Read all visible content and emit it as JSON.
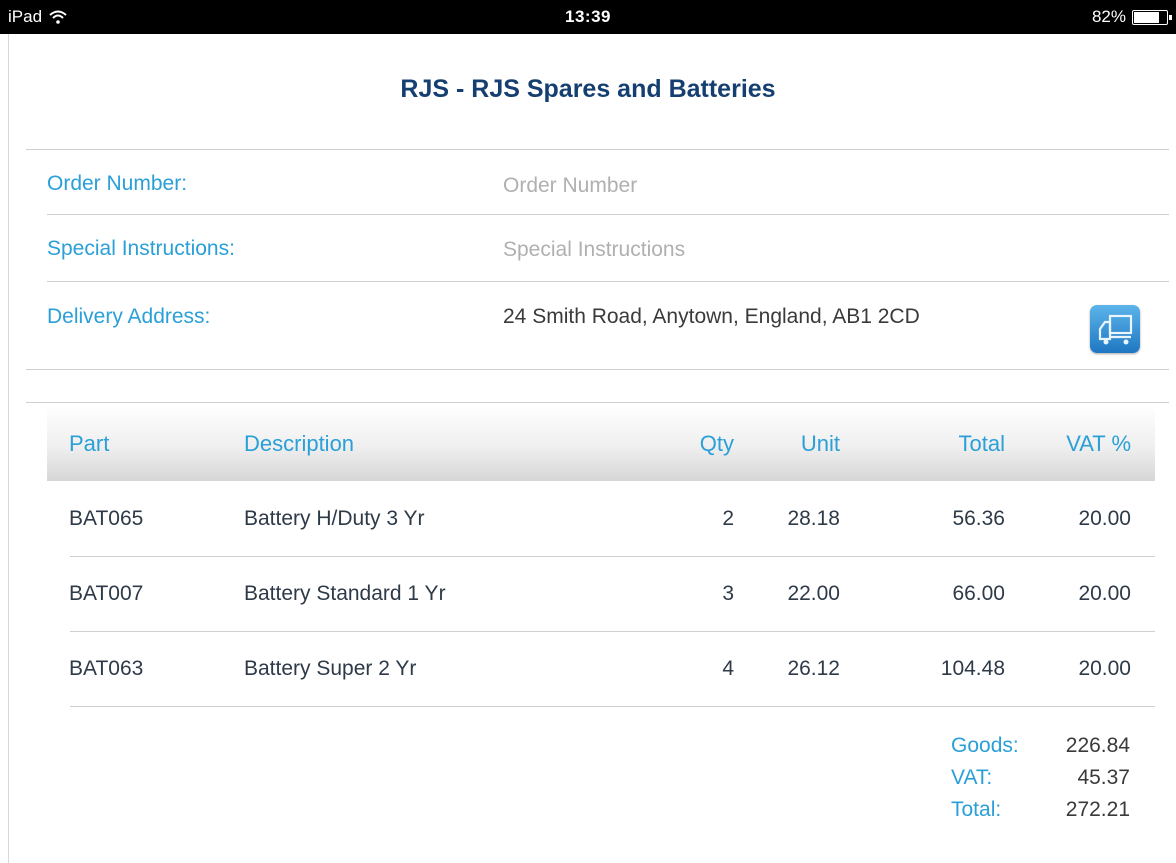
{
  "status_bar": {
    "device": "iPad",
    "time": "13:39",
    "battery": "82%",
    "battery_level": 0.82
  },
  "title": "RJS - RJS Spares and Batteries",
  "form": {
    "order_number": {
      "label": "Order Number:",
      "placeholder": "Order Number",
      "value": ""
    },
    "special_instructions": {
      "label": "Special Instructions:",
      "placeholder": "Special Instructions",
      "value": ""
    },
    "delivery_address": {
      "label": "Delivery Address:",
      "value": "24 Smith Road, Anytown, England, AB1 2CD",
      "button_icon": "delivery-truck-icon"
    }
  },
  "table": {
    "headers": {
      "part": "Part",
      "description": "Description",
      "qty": "Qty",
      "unit": "Unit",
      "total": "Total",
      "vat": "VAT %"
    },
    "rows": [
      {
        "part": "BAT065",
        "description": "Battery H/Duty 3 Yr",
        "qty": "2",
        "unit": "28.18",
        "total": "56.36",
        "vat": "20.00"
      },
      {
        "part": "BAT007",
        "description": "Battery Standard 1 Yr",
        "qty": "3",
        "unit": "22.00",
        "total": "66.00",
        "vat": "20.00"
      },
      {
        "part": "BAT063",
        "description": "Battery Super 2 Yr",
        "qty": "4",
        "unit": "26.12",
        "total": "104.48",
        "vat": "20.00"
      }
    ]
  },
  "totals": {
    "goods_label": "Goods:",
    "goods": "226.84",
    "vat_label": "VAT:",
    "vat": "45.37",
    "total_label": "Total:",
    "total": "272.21"
  },
  "colors": {
    "title": "#153f70",
    "accent": "#2a9fd8",
    "status_bar": "#000000"
  }
}
